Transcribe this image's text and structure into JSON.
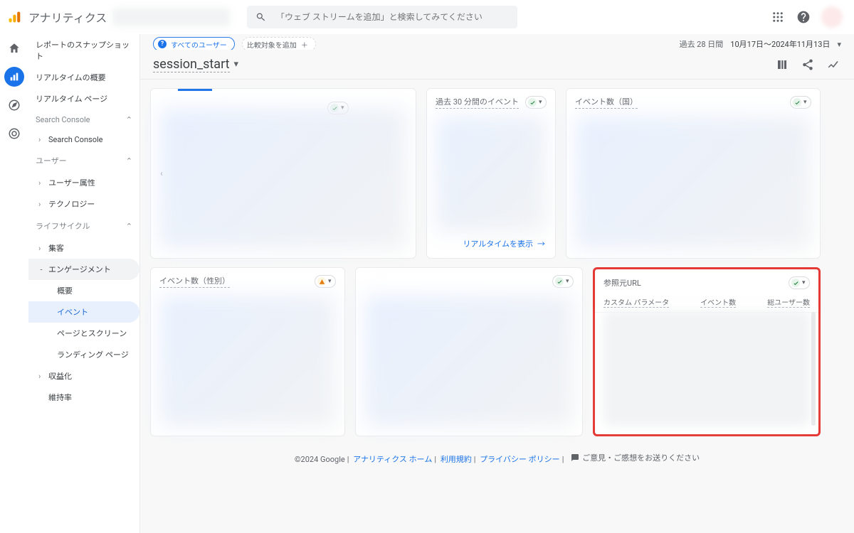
{
  "product_name": "アナリティクス",
  "search": {
    "placeholder": "「ウェブ ストリームを追加」と検索してみてください"
  },
  "rail": {
    "home": "home-icon",
    "reports": "reports-icon",
    "explore": "explore-icon",
    "advertising": "advertising-icon"
  },
  "sidebar": {
    "top": [
      "レポートのスナップショット",
      "リアルタイムの概要",
      "リアルタイム ページ"
    ],
    "search_console_head": "Search Console",
    "search_console_item": "Search Console",
    "user_head": "ユーザー",
    "user_items": [
      "ユーザー属性",
      "テクノロジー"
    ],
    "lifecycle_head": "ライフサイクル",
    "lifecycle": {
      "acquisition": "集客",
      "engagement": "エンゲージメント",
      "engagement_children": [
        "概要",
        "イベント",
        "ページとスクリーン",
        "ランディング ページ"
      ],
      "monetization": "収益化",
      "retention": "維持率"
    },
    "selected": "イベント"
  },
  "header": {
    "chip_primary": "すべてのユーザー",
    "chip_secondary": "比較対象を追加",
    "date_range_label": "過去 28 日間",
    "date_range_value": "10月17日〜2024年11月13日"
  },
  "title_row": {
    "title": "session_start"
  },
  "cards": {
    "realtime_title": "過去 30 分間のイベント",
    "realtime_link": "リアルタイムを表示",
    "country_title": "イベント数（国）",
    "gender_title": "イベント数（性別）",
    "referrer_title": "参照元URL",
    "referrer_cols": [
      "カスタム パラメータ",
      "イベント数",
      "総ユーザー数"
    ]
  },
  "footer": {
    "copyright": "©2024 Google",
    "links": [
      "アナリティクス ホーム",
      "利用規約",
      "プライバシー ポリシー"
    ],
    "feedback": "ご意見・ご感想をお送りください"
  }
}
